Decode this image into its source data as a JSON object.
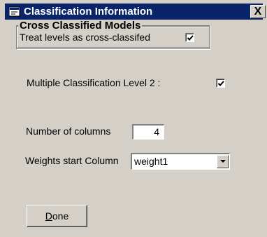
{
  "window": {
    "title": "Classification Information",
    "close_label": "X"
  },
  "cross_classified": {
    "group_title": "Cross Classified Models",
    "treat_levels_label": "Treat levels as cross-classifed",
    "treat_levels_checked": true
  },
  "multiple_classification": {
    "label": "Multiple Classification Level 2 :",
    "checked": true
  },
  "columns": {
    "label": "Number of columns",
    "value": "4"
  },
  "weights": {
    "label": "Weights start Column",
    "selected": "weight1"
  },
  "done_button": {
    "mnemonic": "D",
    "rest": "one"
  }
}
